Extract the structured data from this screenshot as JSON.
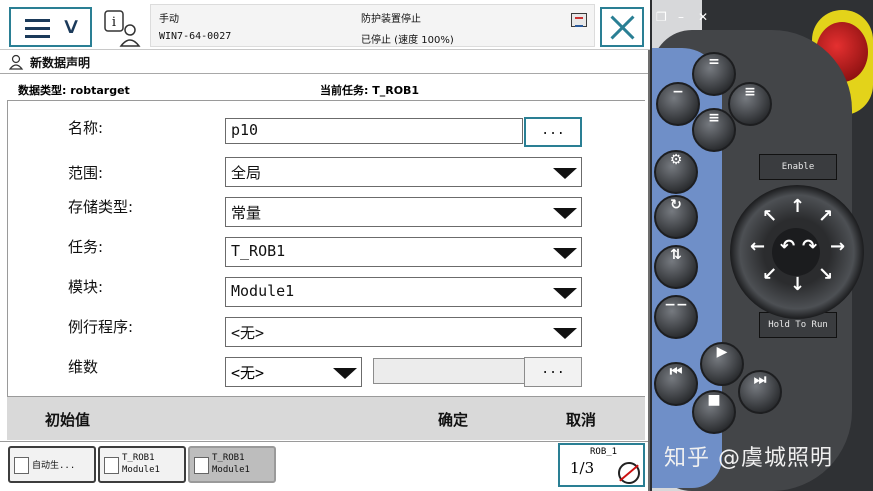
{
  "status": {
    "mode": "手动",
    "host": "WIN7-64-0027",
    "safety": "防护装置停止",
    "state": "已停止 (速度 100%)"
  },
  "window": {
    "title": "新数据声明"
  },
  "meta": {
    "data_type": "数据类型: robtarget",
    "current_task": "当前任务: T_ROB1"
  },
  "form": {
    "name_label": "名称:",
    "name_value": "p10",
    "dots": "...",
    "scope_label": "范围:",
    "scope_value": "全局",
    "storage_label": "存储类型:",
    "storage_value": "常量",
    "task_label": "任务:",
    "task_value": "T_ROB1",
    "module_label": "模块:",
    "module_value": "Module1",
    "routine_label": "例行程序:",
    "routine_value": "<无>",
    "dim_label": "维数",
    "dim_value": "<无>"
  },
  "actions": {
    "initial_value": "初始值",
    "ok": "确定",
    "cancel": "取消"
  },
  "taskbar": {
    "task1": "自动生...",
    "task2": "T_ROB1\nModule1",
    "task3": "T_ROB1\nModule1",
    "qs_robot": "ROB_1",
    "qs_speed": "1/3"
  },
  "pendant": {
    "enable_label": "Enable",
    "hold_label": "Hold To Run"
  },
  "watermark": "知乎 @虞城照明",
  "icons": {
    "menu": "hamburger-chevron-icon",
    "info": "info-user-icon",
    "close": "close-x-icon",
    "title": "user-data-icon"
  }
}
